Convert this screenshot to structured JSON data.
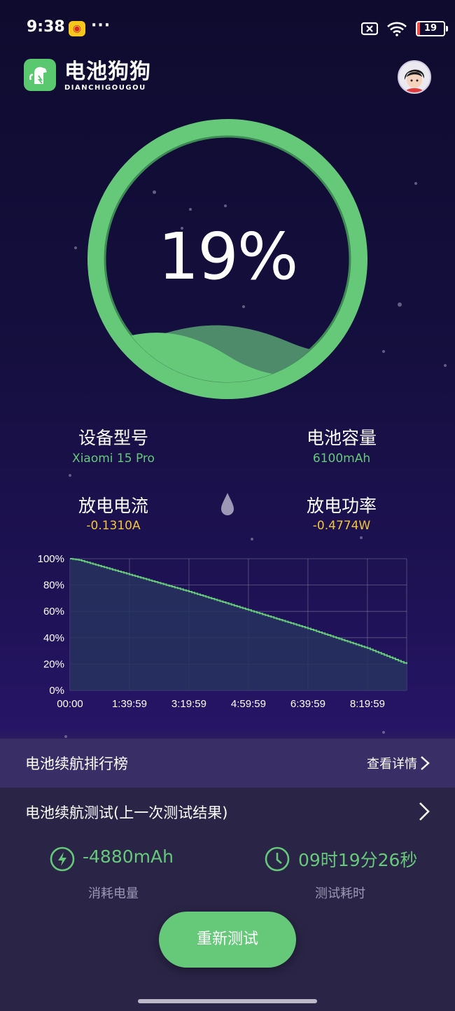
{
  "status_bar": {
    "time": "9:38",
    "battery": "19"
  },
  "app": {
    "name_cn": "电池狗狗",
    "name_en": "DIANCHIGOUGOU"
  },
  "gauge": {
    "percent_text": "19%",
    "level": 0.19,
    "ring_color": "#66c97a"
  },
  "device": {
    "model_label": "设备型号",
    "model_value": "Xiaomi 15 Pro",
    "capacity_label": "电池容量",
    "capacity_value": "6100mAh",
    "current_label": "放电电流",
    "current_value": "-0.1310A",
    "power_label": "放电功率",
    "power_value": "-0.4774W"
  },
  "chart_data": {
    "type": "area",
    "y_ticks": [
      "100%",
      "80%",
      "60%",
      "40%",
      "20%",
      "0%"
    ],
    "x_ticks": [
      "00:00",
      "1:39:59",
      "3:19:59",
      "4:59:59",
      "6:39:59",
      "8:19:59"
    ],
    "ylim": [
      0,
      100
    ],
    "x_minutes_max": 566,
    "series": [
      {
        "x": [
          "00:00",
          "0:15:00",
          "1:39:59",
          "3:19:59",
          "4:59:59",
          "6:39:59",
          "8:19:59",
          "9:26:00"
        ],
        "values": [
          100,
          99,
          88,
          75,
          61,
          47,
          32,
          20
        ]
      }
    ],
    "line_color": "#66c97a",
    "fill_color": "#26335e",
    "grid": true
  },
  "ranking": {
    "title": "电池续航排行榜",
    "link_label": "查看详情"
  },
  "endurance": {
    "title": "电池续航测试(上一次测试结果)",
    "consumption_value": "-4880mAh",
    "consumption_label": "消耗电量",
    "duration_value": "09时19分26秒",
    "duration_label": "测试耗时",
    "retest_label": "重新测试"
  }
}
